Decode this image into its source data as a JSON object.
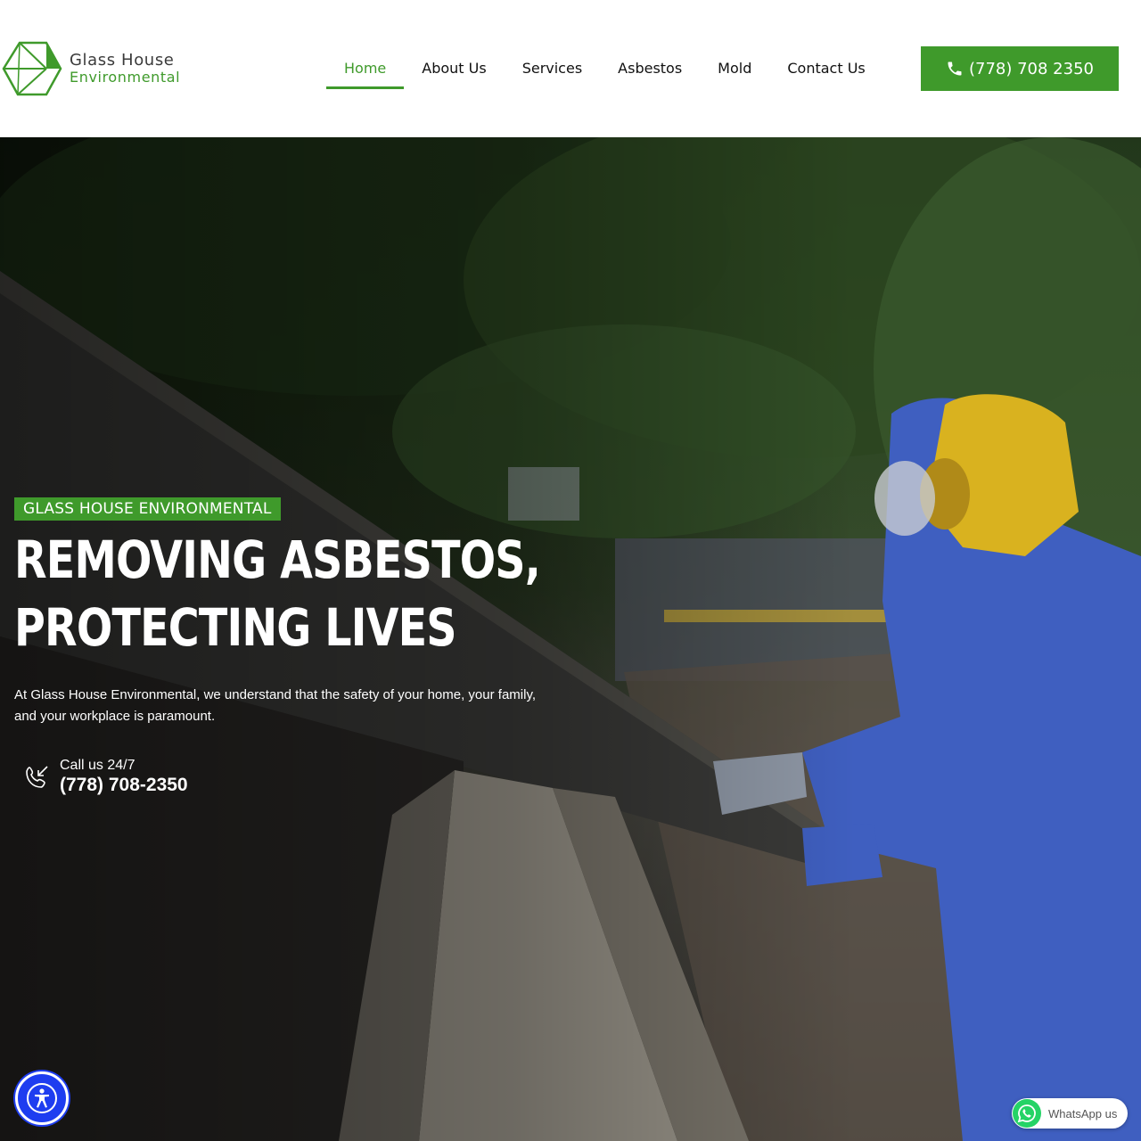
{
  "brand": {
    "name_line1": "Glass House",
    "name_line2": "Environmental",
    "accent_color": "#3f9a2b"
  },
  "nav": {
    "items": [
      {
        "label": "Home",
        "active": true
      },
      {
        "label": "About Us",
        "active": false
      },
      {
        "label": "Services",
        "active": false
      },
      {
        "label": "Asbestos",
        "active": false
      },
      {
        "label": "Mold",
        "active": false
      },
      {
        "label": "Contact Us",
        "active": false
      }
    ]
  },
  "header_call": {
    "icon": "phone-icon",
    "label": "(778) 708 2350"
  },
  "hero": {
    "tag": "GLASS HOUSE ENVIRONMENTAL",
    "headline_line1": "REMOVING ASBESTOS,",
    "headline_line2": "PROTECTING LIVES",
    "intro": "At Glass House Environmental, we understand that the safety of your home, your family, and your workplace is paramount.",
    "call_icon": "phone-incoming-icon",
    "call_label": "Call us 24/7",
    "call_number": "(778) 708-2350"
  },
  "widgets": {
    "accessibility_icon": "accessibility-icon",
    "whatsapp_icon": "whatsapp-icon",
    "whatsapp_label": "WhatsApp us",
    "whatsapp_color": "#25d366"
  }
}
